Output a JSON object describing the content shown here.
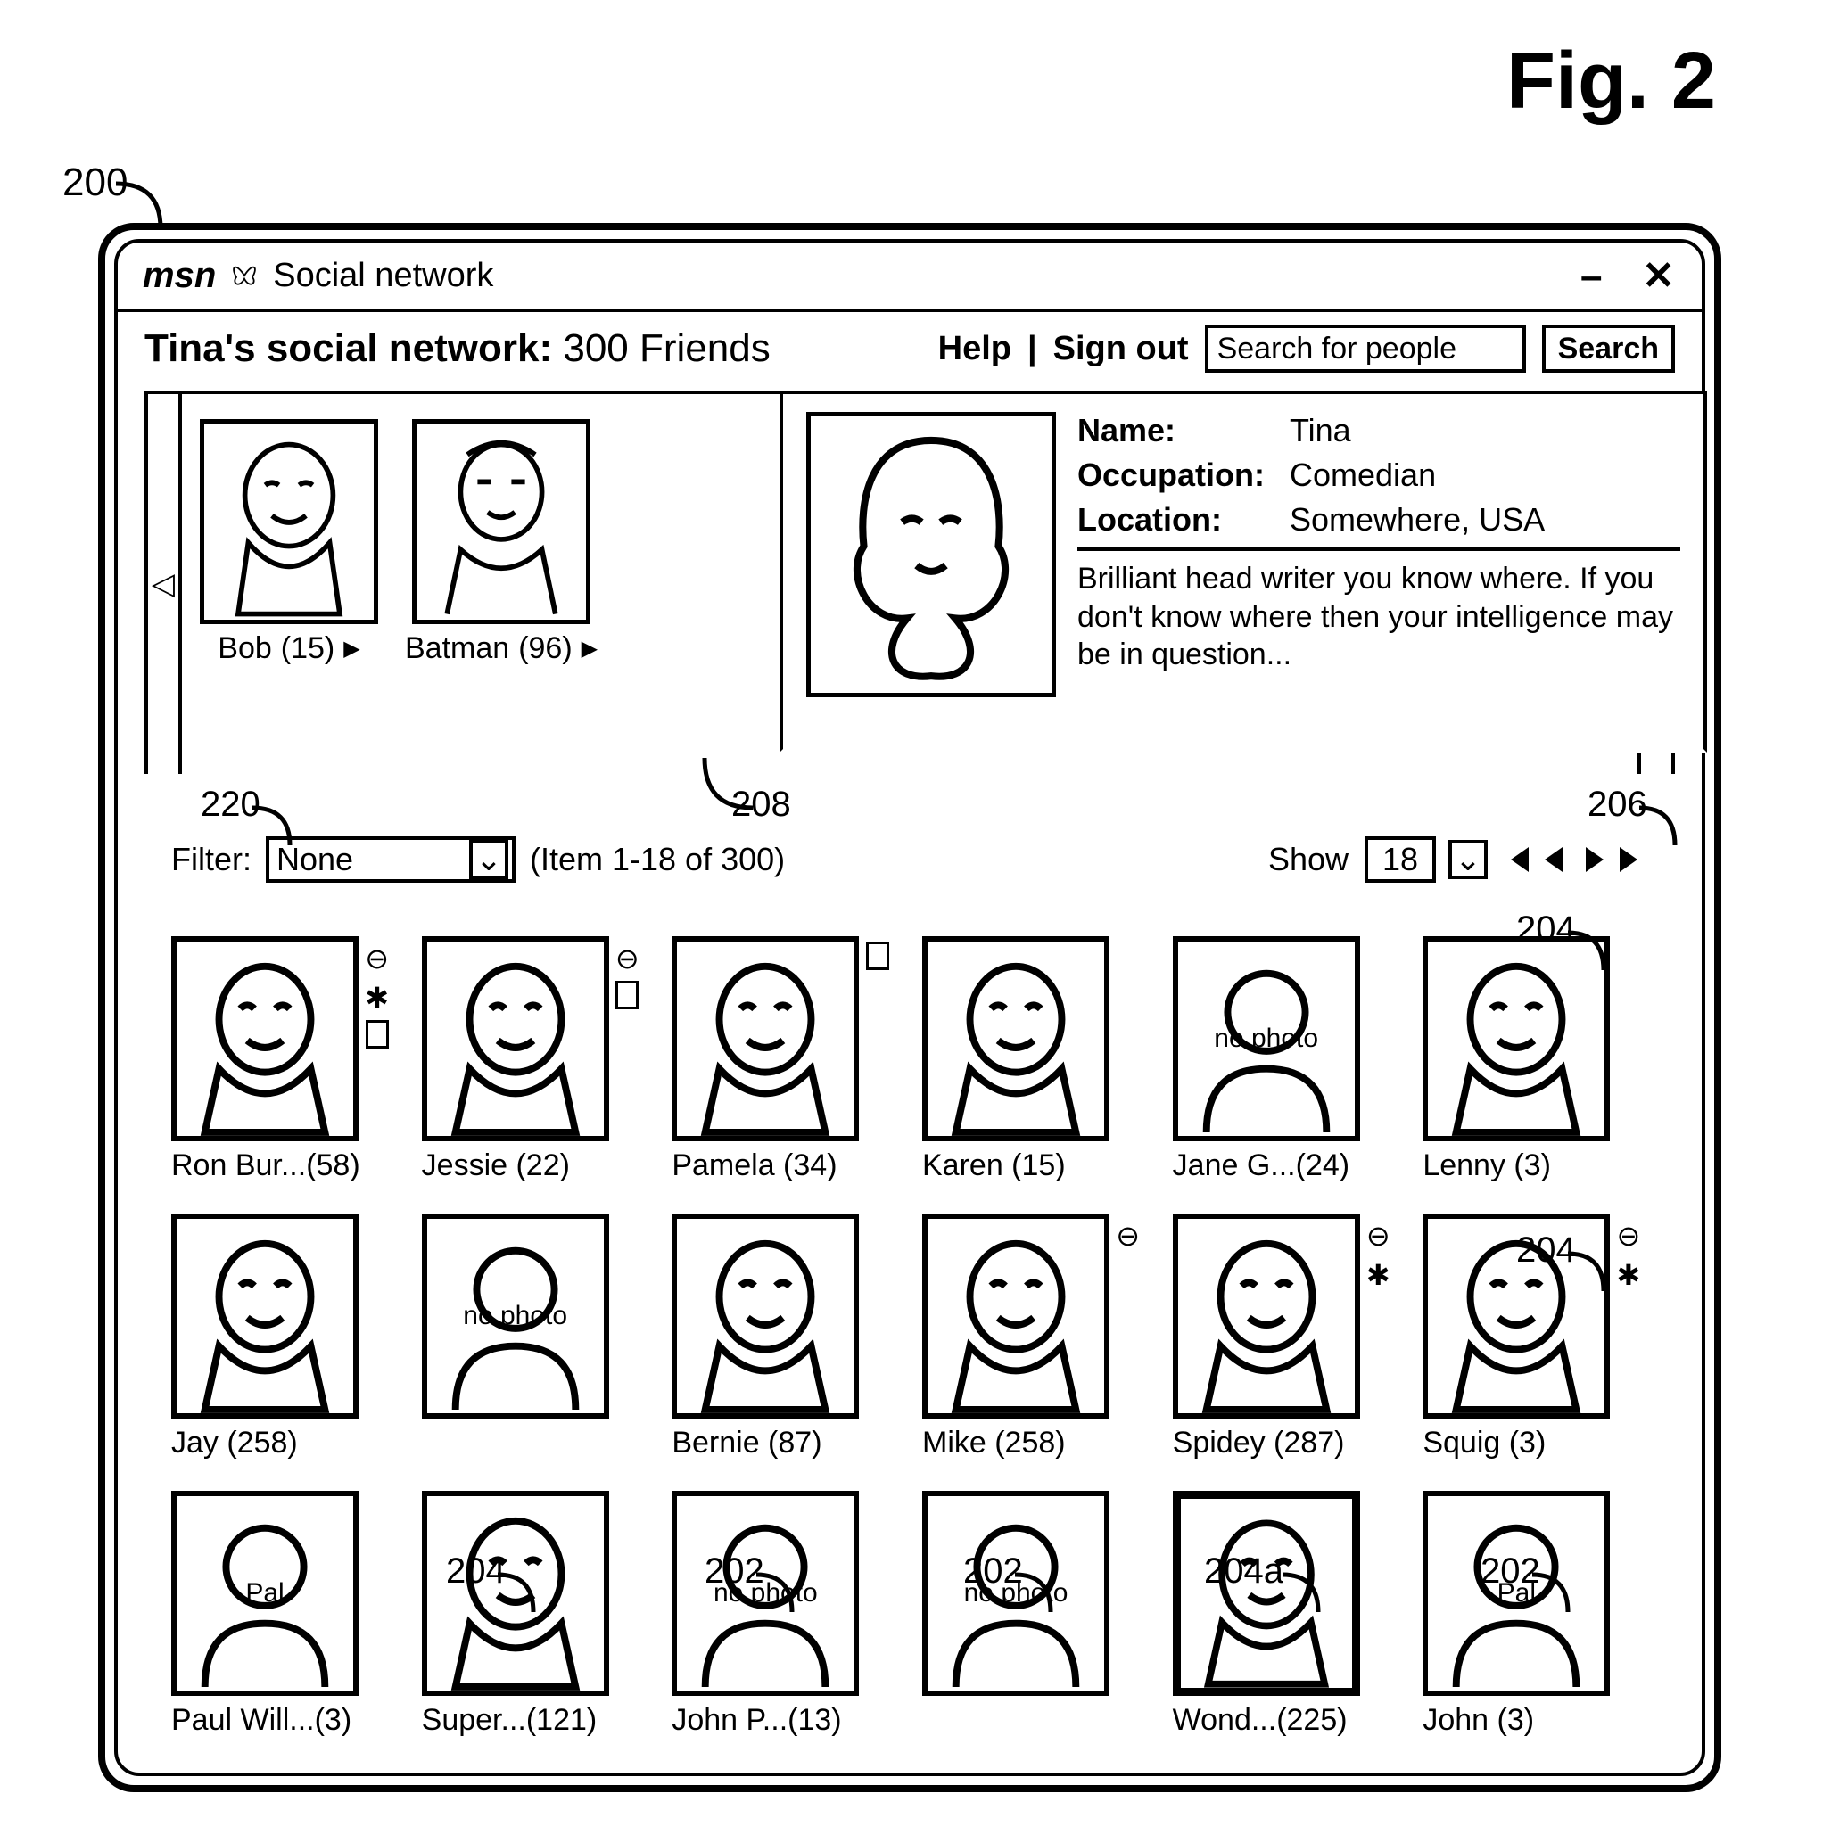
{
  "figure_label": "Fig. 2",
  "window": {
    "brand": "msn",
    "title": "Social network",
    "minimize": "–",
    "close": "✕"
  },
  "header": {
    "owner_label": "Tina's social network:",
    "count_label": "300 Friends",
    "help": "Help",
    "sep": " | ",
    "signout": "Sign out",
    "search_placeholder": "Search for people",
    "search_btn": "Search"
  },
  "breadcrumb": [
    {
      "name": "Bob",
      "count": "(15)"
    },
    {
      "name": "Batman",
      "count": "(96)"
    }
  ],
  "focus": {
    "name_label": "Name:",
    "name_value": "Tina",
    "occ_label": "Occupation:",
    "occ_value": "Comedian",
    "loc_label": "Location:",
    "loc_value": "Somewhere, USA",
    "bio": "Brilliant head writer you know where. If you don't know where then your intelligence may be in question..."
  },
  "filter": {
    "label": "Filter:",
    "value": "None",
    "range": "(Item 1-18 of 300)",
    "show_label": "Show",
    "show_value": "18"
  },
  "grid": [
    {
      "name": "Ron Bur...(58)",
      "badges": [
        "block",
        "star",
        "note"
      ],
      "img": "face"
    },
    {
      "name": "Jessie (22)",
      "badges": [
        "block",
        "note"
      ],
      "img": "face"
    },
    {
      "name": "Pamela (34)",
      "badges": [
        "note"
      ],
      "img": "face"
    },
    {
      "name": "Karen (15)",
      "badges": [],
      "img": "face"
    },
    {
      "name": "Jane G...(24)",
      "badges": [],
      "img": "nophoto"
    },
    {
      "name": "Lenny (3)",
      "badges": [],
      "img": "face"
    },
    {
      "name": "Jay (258)",
      "badges": [],
      "img": "face"
    },
    {
      "name": "",
      "badges": [],
      "img": "nophoto"
    },
    {
      "name": "Bernie (87)",
      "badges": [],
      "img": "face"
    },
    {
      "name": "Mike (258)",
      "badges": [
        "block"
      ],
      "img": "face"
    },
    {
      "name": "Spidey (287)",
      "badges": [
        "block",
        "star"
      ],
      "img": "face"
    },
    {
      "name": "Squig (3)",
      "badges": [
        "block",
        "star"
      ],
      "img": "face"
    },
    {
      "name": "Paul Will...(3)",
      "badges": [],
      "img": "pal"
    },
    {
      "name": "Super...(121)",
      "badges": [],
      "img": "face"
    },
    {
      "name": "John P...(13)",
      "badges": [],
      "img": "nophoto"
    },
    {
      "name": "",
      "badges": [],
      "img": "nophoto"
    },
    {
      "name": "Wond...(225)",
      "badges": [],
      "img": "face",
      "thick": true
    },
    {
      "name": "John (3)",
      "badges": [],
      "img": "pal"
    }
  ],
  "callouts": {
    "c200": "200",
    "c220": "220",
    "c208": "208",
    "c206": "206",
    "c204": "204",
    "c204a": "204a",
    "c202": "202"
  },
  "placeholders": {
    "nophoto": "no photo",
    "pal": "Pal"
  }
}
